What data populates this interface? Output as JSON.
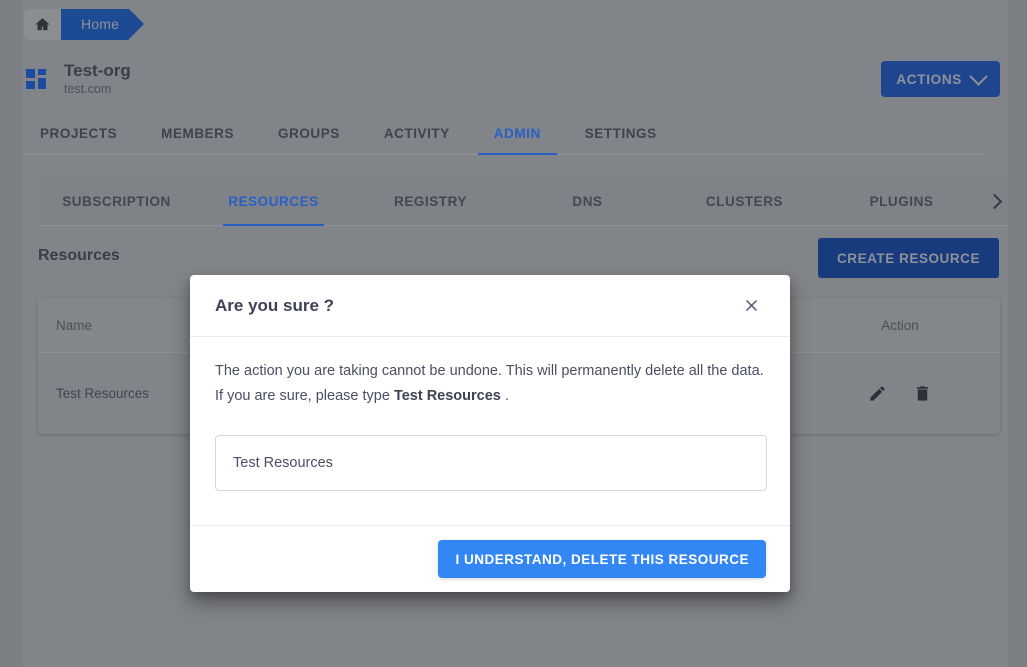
{
  "breadcrumb": {
    "home_icon": "home-icon",
    "current": "Home"
  },
  "org": {
    "logo_icon": "dashboard-grid-icon",
    "name": "Test-org",
    "domain": "test.com"
  },
  "header": {
    "actions_label": "ACTIONS",
    "actions_caret_icon": "chevron-down-icon"
  },
  "primary_tabs": [
    {
      "label": "PROJECTS",
      "active": false
    },
    {
      "label": "MEMBERS",
      "active": false
    },
    {
      "label": "GROUPS",
      "active": false
    },
    {
      "label": "ACTIVITY",
      "active": false
    },
    {
      "label": "ADMIN",
      "active": true
    },
    {
      "label": "SETTINGS",
      "active": false
    }
  ],
  "sub_tabs": [
    {
      "label": "SUBSCRIPTION",
      "active": false
    },
    {
      "label": "RESOURCES",
      "active": true
    },
    {
      "label": "REGISTRY",
      "active": false
    },
    {
      "label": "DNS",
      "active": false
    },
    {
      "label": "CLUSTERS",
      "active": false
    },
    {
      "label": "PLUGINS",
      "active": false
    }
  ],
  "sub_tabs_scroll_icon": "chevron-right-icon",
  "section": {
    "title": "Resources",
    "create_button": "CREATE RESOURCE"
  },
  "table": {
    "columns": [
      "Name",
      "Action"
    ],
    "rows": [
      {
        "name": "Test Resources",
        "edit_icon": "pencil-icon",
        "delete_icon": "trash-icon"
      }
    ]
  },
  "modal": {
    "title": "Are you sure ?",
    "close_icon": "close-icon",
    "body_line1": "The action you are taking cannot be undone. This will permanently delete all the data.",
    "body_line2_prefix": "If you are sure, please type ",
    "body_line2_emphasis": "Test Resources",
    "body_line2_suffix": " .",
    "input_value": "Test Resources",
    "input_placeholder": "",
    "confirm_button": "I UNDERSTAND, DELETE THIS RESOURCE"
  },
  "colors": {
    "brand_blue": "#2a5fc4",
    "dark_blue_button": "#1e458e",
    "confirm_blue": "#3387f5",
    "backdrop": "#7c7f83"
  }
}
